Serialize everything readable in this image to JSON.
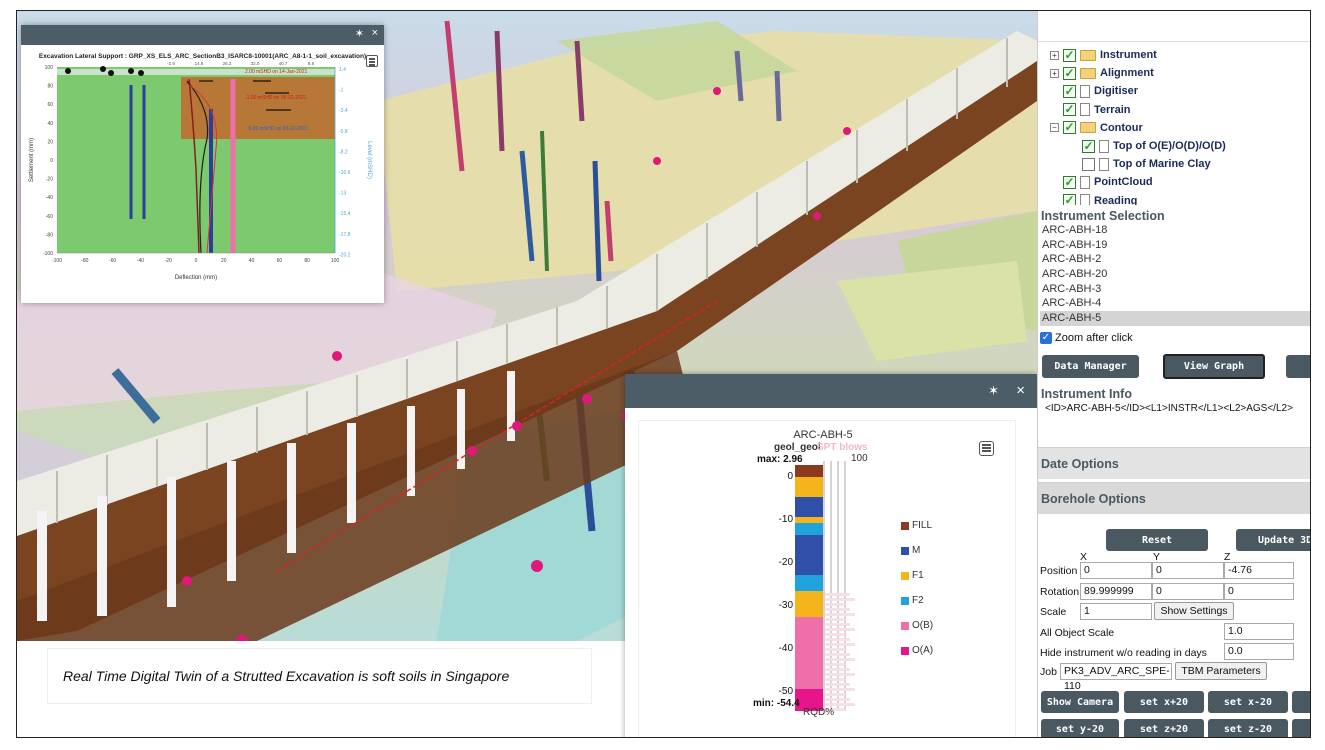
{
  "caption": "Real Time Digital Twin of a Strutted Excavation is soft soils in Singapore",
  "panel1": {
    "title": "Excavation Lateral Support : GRP_XS_ELS_ARC_SectionB3_ISARC8-10001(ARC_A8-1-1_soil_excavation)",
    "pin": "✶",
    "close": "×",
    "ylabel": "Settlement (mm)",
    "y2label": "Level (mSHD)",
    "xlabel": "Deflection (mm)",
    "x_ticks": [
      "-100",
      "-80",
      "-60",
      "-40",
      "-20",
      "0",
      "20",
      "40",
      "60",
      "80",
      "100"
    ],
    "y_ticks": [
      "100",
      "80",
      "60",
      "40",
      "20",
      "0",
      "-20",
      "-40",
      "-60",
      "-80",
      "-100"
    ],
    "y2_ticks": [
      "1.4",
      "-1",
      "-3.4",
      "-5.8",
      "-8.2",
      "-10.6",
      "-13",
      "-15.4",
      "-17.8",
      "-20.2"
    ],
    "top_ticks": [
      "-2.9",
      "14.8",
      "26.2",
      "32.0",
      "40.7",
      "8.8"
    ],
    "annotations": [
      "2.00 mSHD on 14-Jan-2021",
      "-1.00 mSHD on 05-02-2021",
      "-5.90 mSHD on 03-12-2021"
    ]
  },
  "panel2": {
    "pin": "✶",
    "close": "×",
    "title": "ARC-ABH-5",
    "series_label": "geol_geol",
    "spt_label": "SPT blows",
    "spt_max": "100",
    "max_label": "max: 2.96",
    "min_label": "min: -54.4",
    "rqd_label": "RQD%",
    "depth_ticks": [
      "0",
      "-10",
      "-20",
      "-30",
      "-40",
      "-50"
    ],
    "legend": [
      {
        "label": "FILL",
        "color": "#8b3a1e"
      },
      {
        "label": "M",
        "color": "#2f4fa8"
      },
      {
        "label": "F1",
        "color": "#f4b41a"
      },
      {
        "label": "F2",
        "color": "#1fa3dc"
      },
      {
        "label": "O(B)",
        "color": "#ef6fa8"
      },
      {
        "label": "O(A)",
        "color": "#e8148a"
      }
    ]
  },
  "tree": [
    {
      "label": "Instrument",
      "expander": "+",
      "checked": true,
      "type": "folder",
      "indent": 0
    },
    {
      "label": "Alignment",
      "expander": "+",
      "checked": true,
      "type": "folder",
      "indent": 0
    },
    {
      "label": "Digitiser",
      "expander": "",
      "checked": true,
      "type": "doc",
      "indent": 0
    },
    {
      "label": "Terrain",
      "expander": "",
      "checked": true,
      "type": "doc",
      "indent": 0
    },
    {
      "label": "Contour",
      "expander": "−",
      "checked": true,
      "type": "folder",
      "indent": 0
    },
    {
      "label": "Top of O(E)/O(D)/O(D)",
      "expander": "",
      "checked": true,
      "type": "doc",
      "indent": 1
    },
    {
      "label": "Top of Marine Clay",
      "expander": "",
      "checked": false,
      "type": "doc",
      "indent": 1
    },
    {
      "label": "PointCloud",
      "expander": "",
      "checked": true,
      "type": "doc",
      "indent": 0
    },
    {
      "label": "Reading",
      "expander": "",
      "checked": true,
      "type": "doc",
      "indent": 0
    }
  ],
  "instrument_selection": {
    "title": "Instrument Selection",
    "items": [
      "ARC-ABH-18",
      "ARC-ABH-19",
      "ARC-ABH-2",
      "ARC-ABH-20",
      "ARC-ABH-3",
      "ARC-ABH-4",
      "ARC-ABH-5"
    ],
    "selected": "ARC-ABH-5",
    "zoom_label": "Zoom after click"
  },
  "buttons": {
    "data_manager": "Data Manager",
    "view_graph": "View Graph",
    "reset": "Reset",
    "update_3d": "Update 3D",
    "show_settings": "Show Settings",
    "tbm_parameters": "TBM Parameters",
    "show_camera": "Show Camera",
    "set_x_plus": "set x+20",
    "set_x_minus": "set x-20",
    "set_y_minus": "set y-20",
    "set_z_plus": "set z+20",
    "set_z_minus": "set z-20"
  },
  "instrument_info": {
    "title": "Instrument Info",
    "text": "<ID>ARC-ABH-5</ID><L1>INSTR</L1><L2>AGS</L2>"
  },
  "date_options": "Date Options",
  "borehole_options": {
    "title": "Borehole Options",
    "col_x": "X",
    "col_y": "Y",
    "col_z": "Z",
    "position_label": "Position",
    "position": [
      "0",
      "0",
      "-4.76"
    ],
    "rotation_label": "Rotation",
    "rotation": [
      "89.999999",
      "0",
      "0"
    ],
    "scale_label": "Scale",
    "scale": "1",
    "all_scale_label": "All Object Scale",
    "all_scale": "1.0",
    "hide_label": "Hide instrument w/o reading in days",
    "hide_days": "0.0",
    "job_label": "Job",
    "job": "PK3_ADV_ARC_SPE-110"
  }
}
